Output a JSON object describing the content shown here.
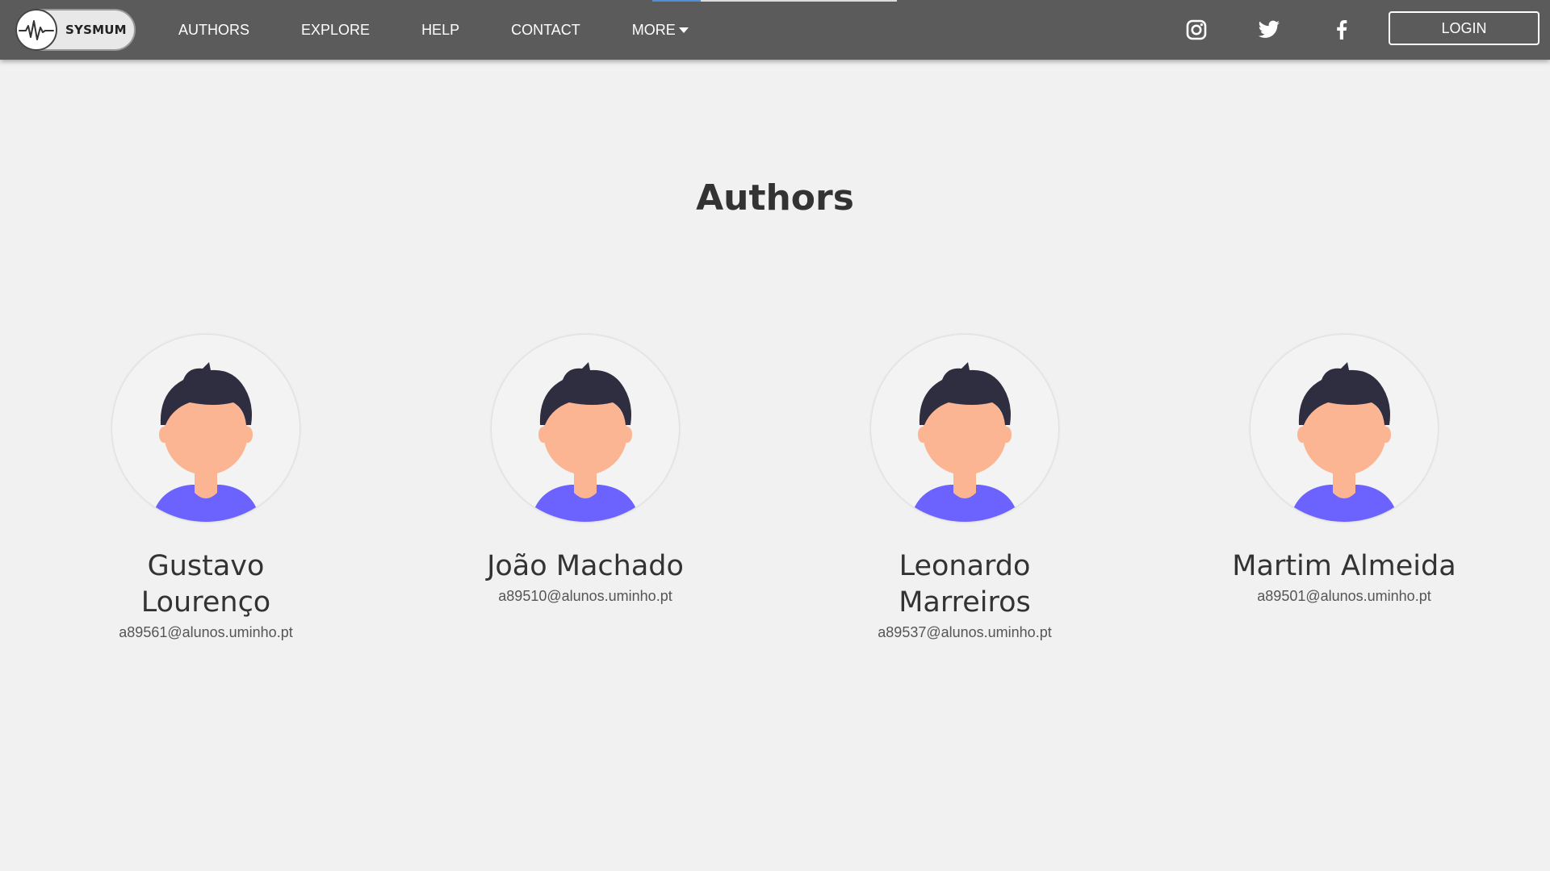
{
  "nav": {
    "logo_text": "SYSMUM",
    "links": [
      "AUTHORS",
      "EXPLORE",
      "HELP",
      "CONTACT",
      "MORE"
    ],
    "login_label": "LOGIN",
    "social_icons": [
      "instagram-icon",
      "twitter-icon",
      "facebook-icon"
    ]
  },
  "page": {
    "title": "Authors"
  },
  "authors": [
    {
      "name": "Gustavo Lourenço",
      "email": "a89561@alunos.uminho.pt"
    },
    {
      "name": "João Machado",
      "email": "a89510@alunos.uminho.pt"
    },
    {
      "name": "Leonardo Marreiros",
      "email": "a89537@alunos.uminho.pt"
    },
    {
      "name": "Martim Almeida",
      "email": "a89501@alunos.uminho.pt"
    }
  ],
  "colors": {
    "navbar": "#5b5b5b",
    "background": "#f1f1f1",
    "avatar_skin": "#fbb592",
    "avatar_hair": "#2f2e41",
    "avatar_shirt": "#6c63ff"
  }
}
